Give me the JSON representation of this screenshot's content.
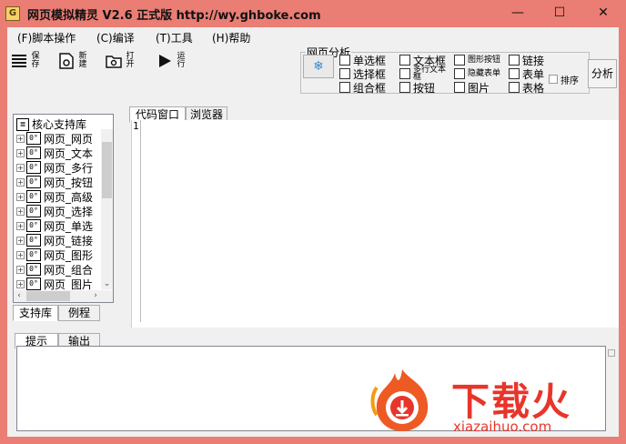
{
  "window": {
    "title": "网页模拟精灵  V2.6 正式版  http://wy.ghboke.com",
    "app_icon_glyph": "G",
    "controls": {
      "minimize": "—",
      "maximize": "☐",
      "close": "✕"
    }
  },
  "menu": [
    {
      "label": "(F)脚本操作"
    },
    {
      "label": "(C)编译"
    },
    {
      "label": "(T)工具"
    },
    {
      "label": "(H)帮助"
    }
  ],
  "toolbar": {
    "save": "保存",
    "new": "新建",
    "open": "打开",
    "run": "运行"
  },
  "analysis": {
    "group_title": "网页分析",
    "checkboxes": {
      "radio": "单选框",
      "select": "选择框",
      "combo": "组合框",
      "textbox": "文本框",
      "multiline": "多行文本框",
      "button": "按钮",
      "image_button": "图形按钮",
      "hidden": "隐藏表单",
      "image": "图片",
      "link": "链接",
      "form": "表单",
      "table": "表格",
      "sort": "排序"
    },
    "analyze_button": "分析"
  },
  "library_tree": {
    "root": "核心支持库",
    "root_icon_glyph": "≣",
    "node_icon_glyph": "0°",
    "items": [
      "网页_网页",
      "网页_文本",
      "网页_多行",
      "网页_按钮",
      "网页_高级",
      "网页_选择",
      "网页_单选",
      "网页_链接",
      "网页_图形",
      "网页_组合",
      "网页_图片"
    ]
  },
  "left_tabs": {
    "library": "支持库",
    "examples": "例程"
  },
  "editor_tabs": {
    "code": "代码窗口",
    "browser": "浏览器"
  },
  "editor": {
    "line_number": "1"
  },
  "bottom_tabs": {
    "hint": "提示",
    "output": "输出"
  },
  "watermark": {
    "text": "下载火",
    "url": "xiazaihuo.com",
    "color": "#e8352b"
  }
}
